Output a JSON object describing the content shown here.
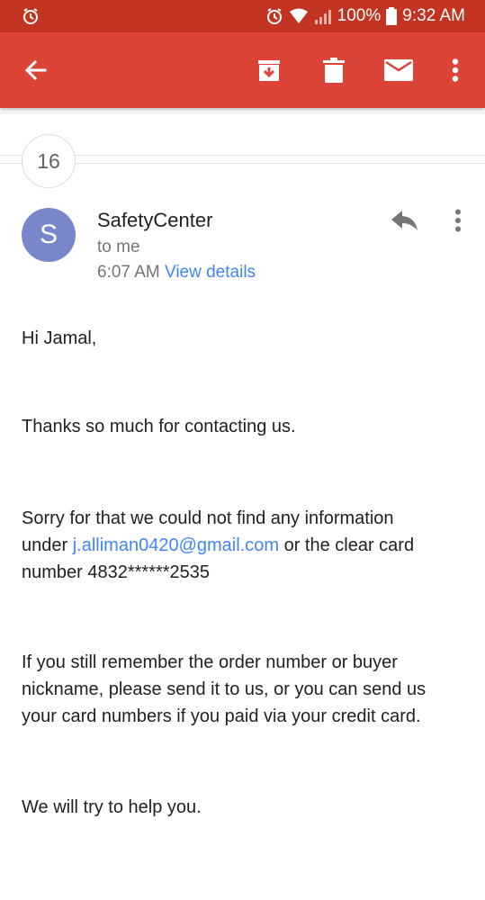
{
  "status_bar": {
    "battery": "100%",
    "time": "9:32 AM",
    "icons": [
      "alarm-status-icon",
      "alarm-icon",
      "wifi-icon",
      "signal-icon",
      "battery-icon"
    ]
  },
  "app_bar": {
    "color": "#db4437",
    "actions": [
      "back-arrow-icon",
      "archive-icon",
      "delete-icon",
      "mark-unread-icon",
      "overflow-menu-icon"
    ]
  },
  "thread": {
    "collapsed_count": "16"
  },
  "message": {
    "avatar_letter": "S",
    "avatar_color": "#7986cb",
    "sender": "SafetyCenter",
    "recipient": "to me",
    "time": "6:07 AM",
    "details_link": "View details",
    "body": {
      "greeting": "Hi  Jamal,",
      "p1": "Thanks so much for contacting us.",
      "p2_line1": "Sorry for that we could not find any information",
      "p2_under": "under",
      "p2_email": "j.alliman0420@gmail.com",
      "p2_rest": "or the clear card",
      "p2_line3": "number 4832******2535",
      "p3_line1": "If you still remember the order number or buyer",
      "p3_line2": "nickname, please send it to us, or you can send us",
      "p3_line3": "your card numbers if you paid via your credit card.",
      "p4": "We will try to help you."
    }
  }
}
